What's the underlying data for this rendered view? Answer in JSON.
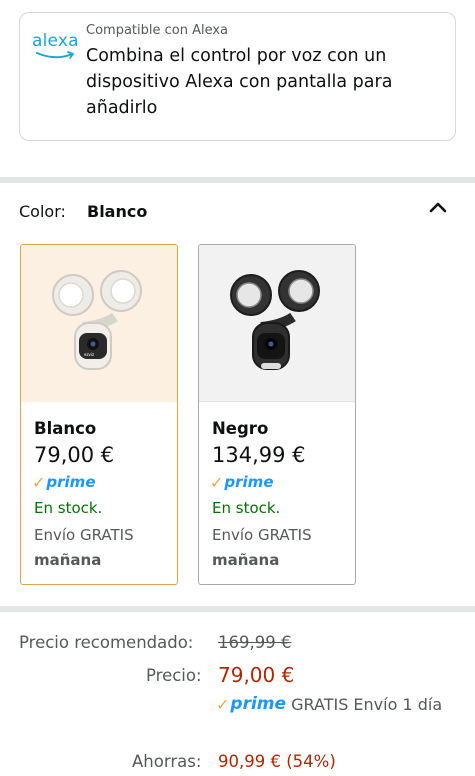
{
  "alexa": {
    "logo_text": "alexa",
    "compatible_label": "Compatible con Alexa",
    "description": "Combina el control por voz con un dispositivo Alexa con pantalla para añadirlo"
  },
  "color_selector": {
    "label": "Color:",
    "selected_value": "Blanco",
    "options": [
      {
        "name": "Blanco",
        "price": "79,00 €",
        "prime": "prime",
        "stock": "En stock.",
        "shipping": "Envío GRATIS",
        "delivery_day": "mañana",
        "selected": true
      },
      {
        "name": "Negro",
        "price": "134,99 €",
        "prime": "prime",
        "stock": "En stock.",
        "shipping": "Envío GRATIS",
        "delivery_day": "mañana",
        "selected": false
      }
    ]
  },
  "pricing": {
    "recommended_label": "Precio recomendado:",
    "recommended_value": "169,99 €",
    "price_label": "Precio:",
    "price_value": "79,00 €",
    "prime_label": "prime",
    "prime_shipping": "GRATIS Envío 1 día",
    "savings_label": "Ahorras:",
    "savings_value": "90,99 € (54%)"
  },
  "colors": {
    "price_red": "#b12704",
    "stock_green": "#007600",
    "prime_blue": "#1a98ff",
    "selected_border": "#e3a34a",
    "alexa_blue": "#1aa7d6"
  }
}
